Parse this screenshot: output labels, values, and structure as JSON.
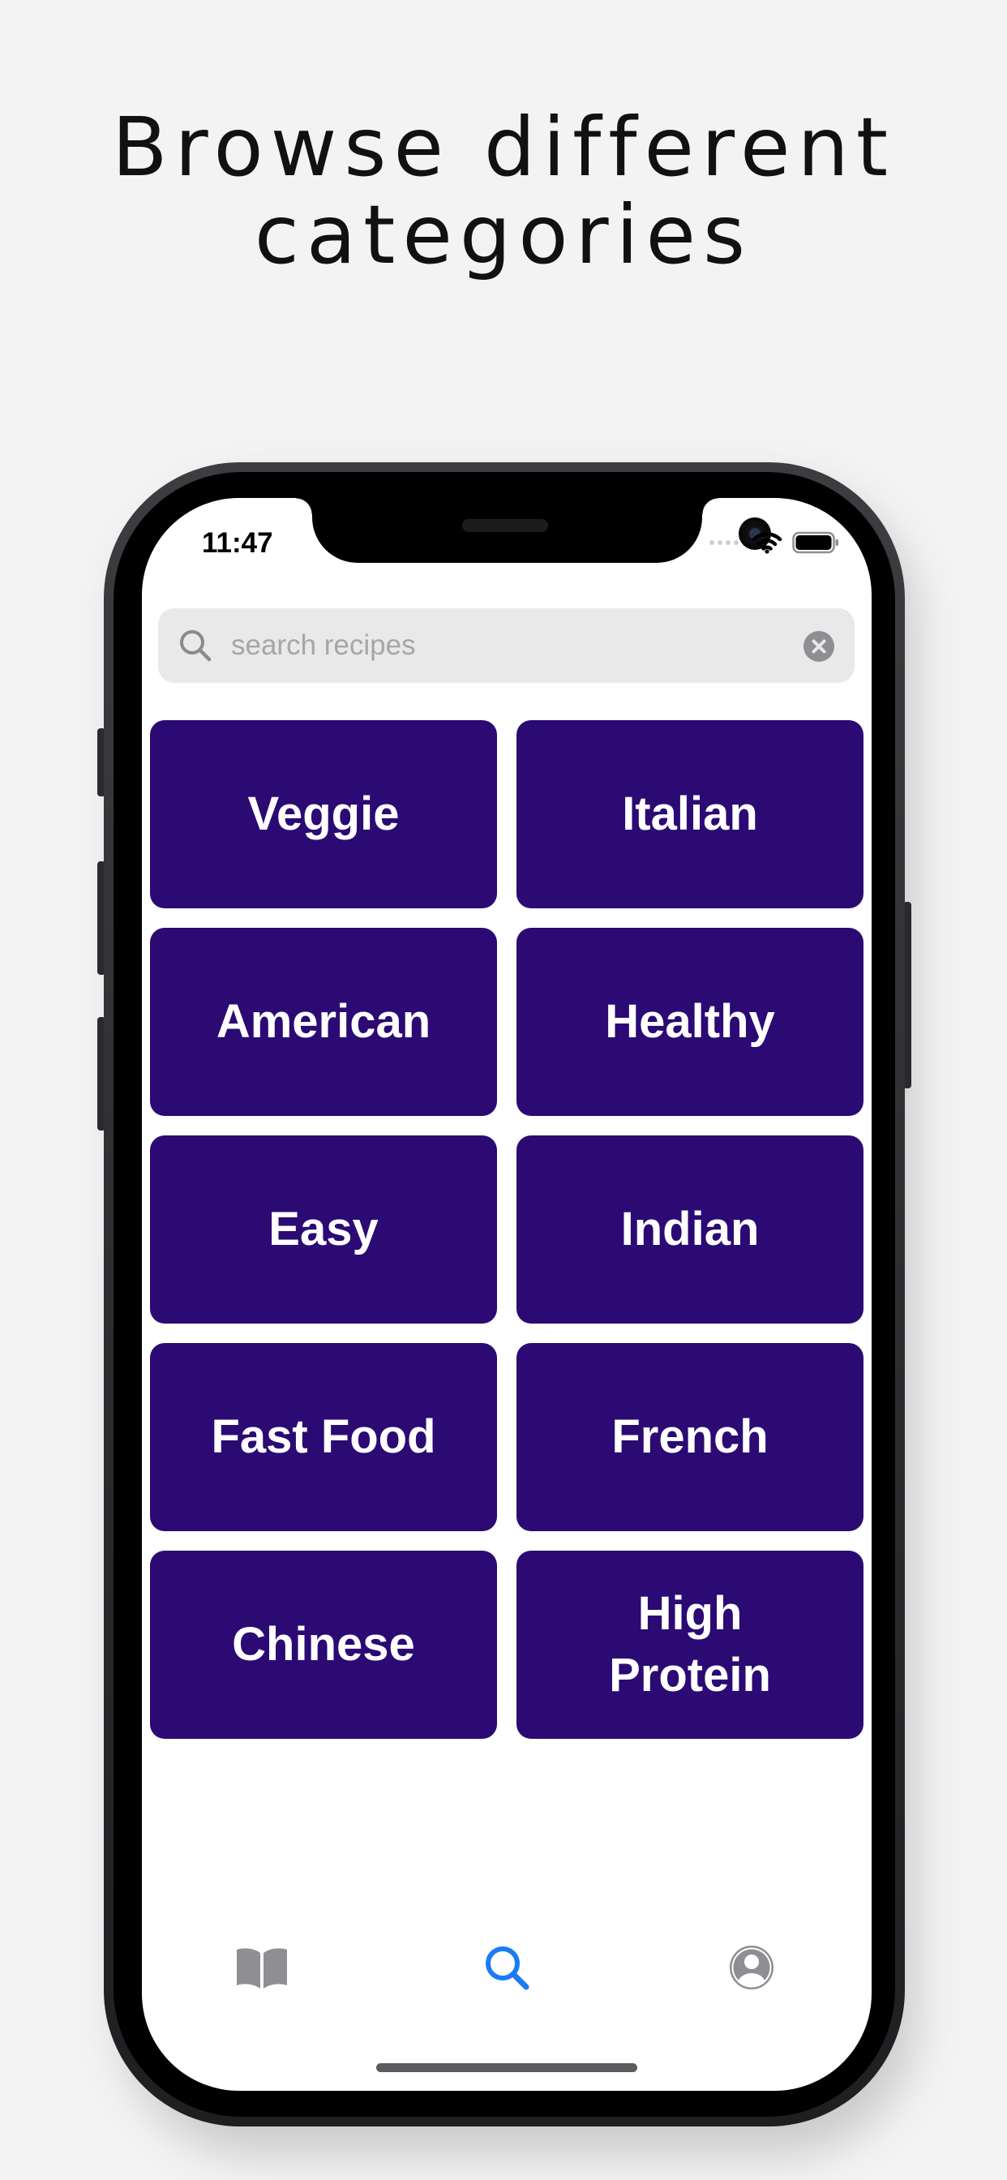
{
  "headline": {
    "line1": "Browse different",
    "line2": "categories"
  },
  "status_bar": {
    "time": "11:47"
  },
  "search": {
    "placeholder": "search recipes",
    "value": ""
  },
  "categories": [
    {
      "label": "Veggie"
    },
    {
      "label": "Italian"
    },
    {
      "label": "American"
    },
    {
      "label": "Healthy"
    },
    {
      "label": "Easy"
    },
    {
      "label": "Indian"
    },
    {
      "label": "Fast Food"
    },
    {
      "label": "French"
    },
    {
      "label": "Chinese"
    },
    {
      "label": "High Protein"
    }
  ],
  "tab_bar": {
    "tabs": [
      {
        "icon": "book-icon",
        "active": false
      },
      {
        "icon": "search-icon",
        "active": true
      },
      {
        "icon": "profile-icon",
        "active": false
      }
    ]
  },
  "colors": {
    "page_background": "#f3f3f3",
    "category_tile": "#2b0a74",
    "tab_active": "#1a7cf4",
    "tab_inactive": "#8e8e93"
  }
}
